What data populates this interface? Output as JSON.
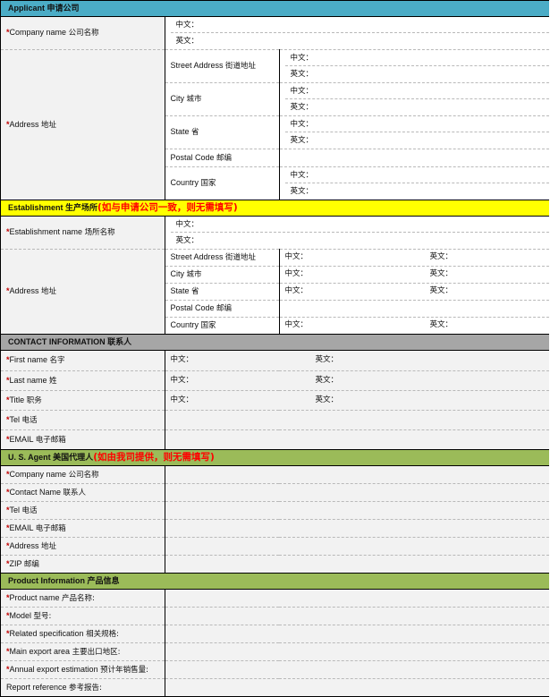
{
  "meta": {
    "colors": {
      "applicant_header": "#4BACC6",
      "establishment_header": "#FFFF00",
      "contact_header": "#A6A6A6",
      "agent_header": "#9BBB59",
      "product_header": "#9BBB59",
      "required_star": "#C00000",
      "note_red": "#FF0000",
      "label_shade": "#F2F2F2"
    },
    "field_labels": {
      "chinese": "中文：",
      "english": "英文："
    }
  },
  "sections": {
    "applicant": {
      "header_en": "Applicant ",
      "header_cn": "申请公司",
      "header_note": "",
      "rows": {
        "company_name": {
          "star": "*",
          "en": "Company name ",
          "cn": "公司名称"
        },
        "address": {
          "star": "*",
          "en": "Address ",
          "cn": "地址"
        }
      },
      "address_parts": [
        {
          "en": "Street Address ",
          "cn": "街道地址"
        },
        {
          "en": "City ",
          "cn": "城市"
        },
        {
          "en": "State ",
          "cn": "省"
        },
        {
          "en": "Postal Code ",
          "cn": "邮编"
        },
        {
          "en": "Country ",
          "cn": "国家"
        }
      ]
    },
    "establishment": {
      "header_en": "Establishment ",
      "header_cn": "生产场所",
      "header_note": "(如与申请公司一致，则无需填写)",
      "rows": {
        "establishment_name": {
          "star": "*",
          "en": "Establishment name ",
          "cn": "场所名称"
        },
        "address": {
          "star": "*",
          "en": "Address ",
          "cn": "地址"
        }
      },
      "address_parts": [
        {
          "en": "Street Address ",
          "cn": "街道地址"
        },
        {
          "en": "City ",
          "cn": "城市"
        },
        {
          "en": "State ",
          "cn": "省"
        },
        {
          "en": "Postal Code ",
          "cn": "邮编"
        },
        {
          "en": "Country ",
          "cn": "国家"
        }
      ]
    },
    "contact": {
      "header_en": "CONTACT INFORMATION ",
      "header_cn": "联系人",
      "header_note": "",
      "rows": [
        {
          "star": "*",
          "en": "First name ",
          "cn": "名字",
          "bilingual": true
        },
        {
          "star": "*",
          "en": "Last name ",
          "cn": "姓",
          "bilingual": true
        },
        {
          "star": "*",
          "en": "Title ",
          "cn": "职务",
          "bilingual": true
        },
        {
          "star": "*",
          "en": "Tel ",
          "cn": "电话",
          "bilingual": false
        },
        {
          "star": "*",
          "en": "EMAIL ",
          "cn": "电子邮箱",
          "bilingual": false
        }
      ]
    },
    "agent": {
      "header_en": "U. S. Agent ",
      "header_cn": "美国代理人",
      "header_note": "(如由我司提供，则无需填写)",
      "rows": [
        {
          "star": "*",
          "en": "Company name ",
          "cn": "公司名称"
        },
        {
          "star": "*",
          "en": "Contact Name ",
          "cn": "联系人"
        },
        {
          "star": "*",
          "en": "Tel ",
          "cn": "电话"
        },
        {
          "star": "*",
          "en": "EMAIL ",
          "cn": "电子邮箱"
        },
        {
          "star": "*",
          "en": "Address ",
          "cn": "地址"
        },
        {
          "star": "*",
          "en": "ZIP ",
          "cn": "邮编"
        }
      ]
    },
    "product": {
      "header_en": "Product Information ",
      "header_cn": "产品信息",
      "header_note": "",
      "rows": [
        {
          "star": "*",
          "en": "Product name ",
          "cn": "产品名称:"
        },
        {
          "star": "*",
          "en": "Model ",
          "cn": "型号:"
        },
        {
          "star": "*",
          "en": "Related specification ",
          "cn": "相关规格:"
        },
        {
          "star": "*",
          "en": "Main export area ",
          "cn": "主要出口地区:"
        },
        {
          "star": "*",
          "en": "Annual export estimation ",
          "cn": "预计年销售量:"
        },
        {
          "star": "",
          "en": " Report reference ",
          "cn": "参考报告:"
        }
      ]
    }
  }
}
